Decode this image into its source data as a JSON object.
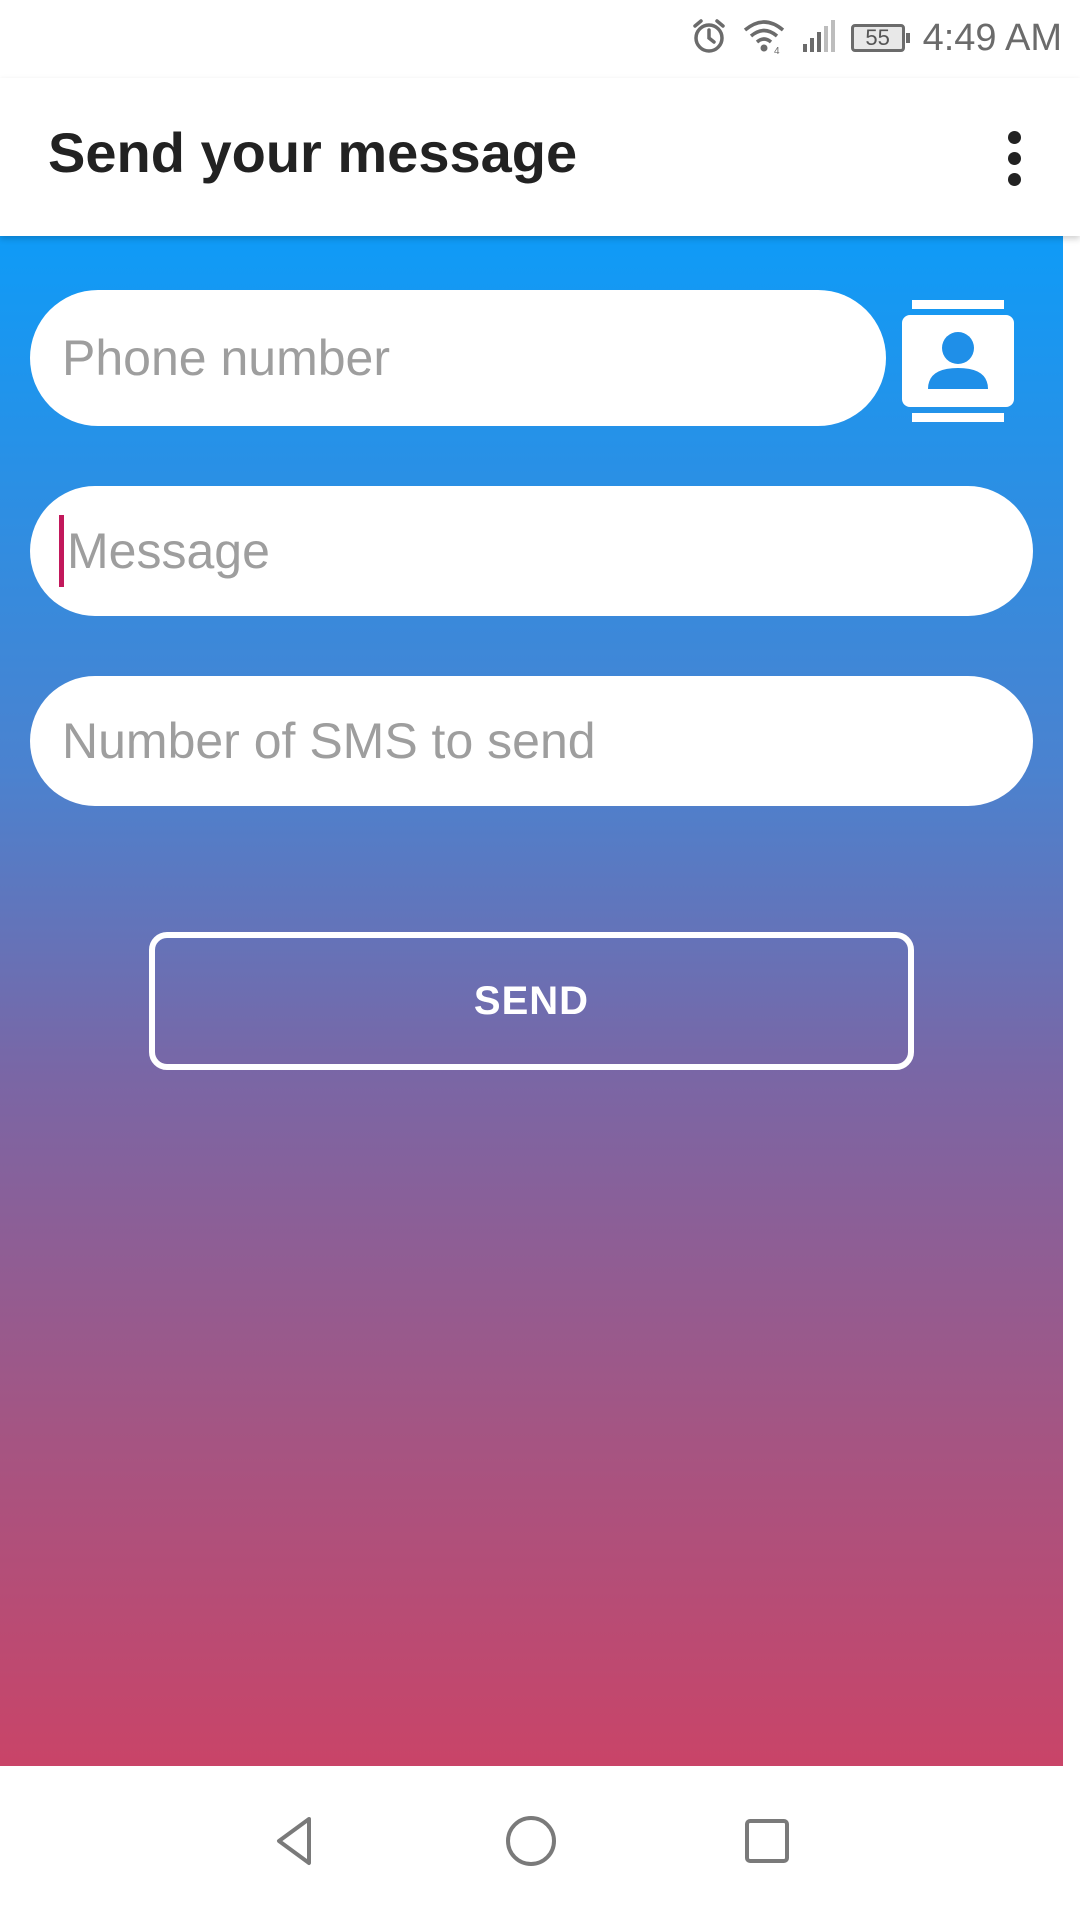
{
  "status_bar": {
    "time": "4:49 AM",
    "battery_level": "55",
    "icons": [
      "alarm-icon",
      "wifi-icon",
      "signal-icon",
      "battery-icon"
    ]
  },
  "app_bar": {
    "title": "Send your message",
    "menu_icon": "overflow-menu-icon"
  },
  "form": {
    "phone": {
      "placeholder": "Phone number",
      "value": ""
    },
    "message": {
      "placeholder": "Message",
      "value": ""
    },
    "sms_count": {
      "placeholder": "Number of SMS to send",
      "value": ""
    },
    "contact_icon": "contact-picker-icon",
    "send_label": "SEND"
  },
  "nav_bar": {
    "icons": [
      "back-icon",
      "home-icon",
      "recents-icon"
    ]
  },
  "colors": {
    "gradient_top": "#0f9bf7",
    "gradient_bottom": "#c94468",
    "cursor": "#c2185b",
    "title_text": "#222222",
    "placeholder_text": "#9e9e9e"
  }
}
